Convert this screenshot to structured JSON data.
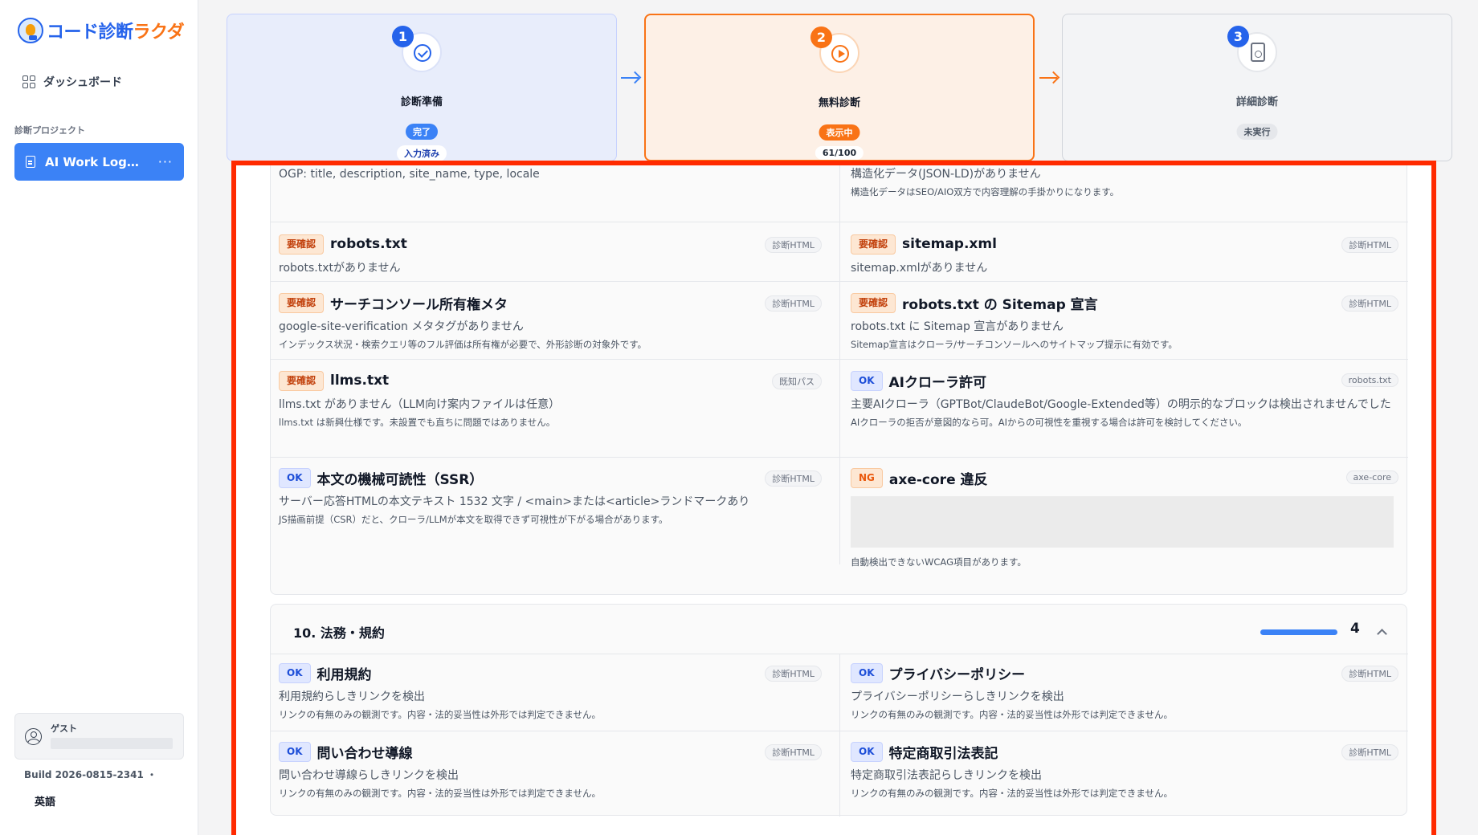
{
  "app": {
    "logo_main": "コード診断",
    "logo_accent": "ラクダ"
  },
  "sidebar": {
    "dashboard_label": "ダッシュボード",
    "section_label": "診断プロジェクト",
    "project_label": "AI Work Log…",
    "more": "···",
    "guest_label": "ゲスト",
    "build": "Build 2026-0815-2341 ・",
    "language": "英語"
  },
  "steps": [
    {
      "num": "1",
      "title": "診断準備",
      "badge": "完了",
      "sub": "入力済み"
    },
    {
      "num": "2",
      "title": "無料診断",
      "badge": "表示中",
      "sub": "61/100"
    },
    {
      "num": "3",
      "title": "詳細診断",
      "badge": "未実行",
      "sub": ""
    }
  ],
  "group1": {
    "rows": [
      {
        "left": {
          "badge": "",
          "title": "",
          "source": "",
          "desc": "OGP: title, description, site_name, type, locale",
          "note": ""
        },
        "right": {
          "badge": "",
          "title": "",
          "source": "",
          "desc": "構造化データ(JSON-LD)がありません",
          "note": "構造化データはSEO/AIO双方で内容理解の手掛かりになります。"
        }
      },
      {
        "left": {
          "badge": "要確認",
          "title": "robots.txt",
          "source": "診断HTML",
          "desc": "robots.txtがありません",
          "note": ""
        },
        "right": {
          "badge": "要確認",
          "title": "sitemap.xml",
          "source": "診断HTML",
          "desc": "sitemap.xmlがありません",
          "note": ""
        }
      },
      {
        "left": {
          "badge": "要確認",
          "title": "サーチコンソール所有権メタ",
          "source": "診断HTML",
          "desc": "google-site-verification メタタグがありません",
          "note": "インデックス状況・検索クエリ等のフル評価は所有権が必要で、外形診断の対象外です。"
        },
        "right": {
          "badge": "要確認",
          "title": "robots.txt の Sitemap 宣言",
          "source": "診断HTML",
          "desc": "robots.txt に Sitemap 宣言がありません",
          "note": "Sitemap宣言はクローラ/サーチコンソールへのサイトマップ提示に有効です。"
        }
      },
      {
        "left": {
          "badge": "要確認",
          "title": "llms.txt",
          "source": "既知パス",
          "desc": "llms.txt がありません（LLM向け案内ファイルは任意）",
          "note": "llms.txt は新興仕様です。未設置でも直ちに問題ではありません。"
        },
        "right": {
          "badge": "OK",
          "title": "AIクローラ許可",
          "source": "robots.txt",
          "desc": "主要AIクローラ（GPTBot/ClaudeBot/Google-Extended等）の明示的なブロックは検出されませんでした",
          "note": "AIクローラの拒否が意図的なら可。AIからの可視性を重視する場合は許可を検討してください。"
        }
      },
      {
        "left": {
          "badge": "OK",
          "title": "本文の機械可読性（SSR）",
          "source": "診断HTML",
          "desc": "サーバー応答HTMLの本文テキスト 1532 文字 / <main>または<article>ランドマークあり",
          "note": "JS描画前提（CSR）だと、クローラ/LLMが本文を取得できず可視性が下がる場合があります。"
        },
        "right": {
          "badge": "NG",
          "title": "axe-core 違反",
          "source": "axe-core",
          "desc": "",
          "note": "自動検出できないWCAG項目があります。"
        }
      }
    ]
  },
  "group2": {
    "title": "10. 法務・規約",
    "progress": 1.0,
    "count": "4",
    "rows": [
      {
        "left": {
          "badge": "OK",
          "title": "利用規約",
          "source": "診断HTML",
          "desc": "利用規約らしきリンクを検出",
          "note": "リンクの有無のみの観測です。内容・法的妥当性は外形では判定できません。"
        },
        "right": {
          "badge": "OK",
          "title": "プライバシーポリシー",
          "source": "診断HTML",
          "desc": "プライバシーポリシーらしきリンクを検出",
          "note": "リンクの有無のみの観測です。内容・法的妥当性は外形では判定できません。"
        }
      },
      {
        "left": {
          "badge": "OK",
          "title": "問い合わせ導線",
          "source": "診断HTML",
          "desc": "問い合わせ導線らしきリンクを検出",
          "note": "リンクの有無のみの観測です。内容・法的妥当性は外形では判定できません。"
        },
        "right": {
          "badge": "OK",
          "title": "特定商取引法表記",
          "source": "診断HTML",
          "desc": "特定商取引法表記らしきリンクを検出",
          "note": "リンクの有無のみの観測です。内容・法的妥当性は外形では判定できません。"
        }
      }
    ]
  }
}
